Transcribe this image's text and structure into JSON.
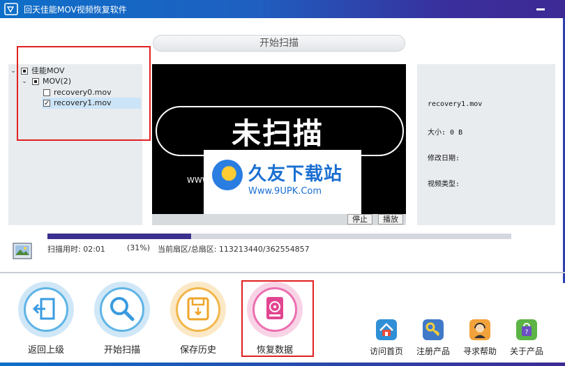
{
  "window": {
    "title": "回天佳能MOV视频恢复软件",
    "accent": "#1f5fc0"
  },
  "scan_banner": {
    "label": "开始扫描"
  },
  "tree": {
    "root": {
      "label": "佳能MOV",
      "state": "partial"
    },
    "folder": {
      "label": "MOV(2)",
      "state": "partial"
    },
    "files": [
      {
        "label": "recovery0.mov",
        "checked": false,
        "selected": false
      },
      {
        "label": "recovery1.mov",
        "checked": true,
        "selected": true
      }
    ]
  },
  "preview": {
    "caption": "未扫描",
    "stop_label": "停止",
    "play_label": "播放",
    "watermark_title": "久友下载站",
    "watermark_url": "Www.9UPK.Com",
    "watermark_side": "WWW.9U"
  },
  "info": {
    "filename": "recovery1.mov",
    "size": "大小: 0 B",
    "modified": "修改日期:",
    "type": "视频类型:"
  },
  "progress": {
    "fraction": 0.31,
    "elapsed": "扫描用时: 02:01",
    "percent": "(31%)",
    "sector": "当前扇区/总扇区: 113213440/362554857"
  },
  "actions": [
    {
      "label": "返回上级",
      "icon": "back-door-icon"
    },
    {
      "label": "开始扫描",
      "icon": "magnifier-icon"
    },
    {
      "label": "保存历史",
      "icon": "floppy-save-icon"
    },
    {
      "label": "恢复数据",
      "icon": "hard-drive-recover-icon"
    }
  ],
  "links": [
    {
      "label": "访问首页",
      "icon": "home-icon"
    },
    {
      "label": "注册产品",
      "icon": "key-icon"
    },
    {
      "label": "寻求帮助",
      "icon": "support-agent-icon"
    },
    {
      "label": "关于产品",
      "icon": "shopping-bag-icon"
    }
  ]
}
